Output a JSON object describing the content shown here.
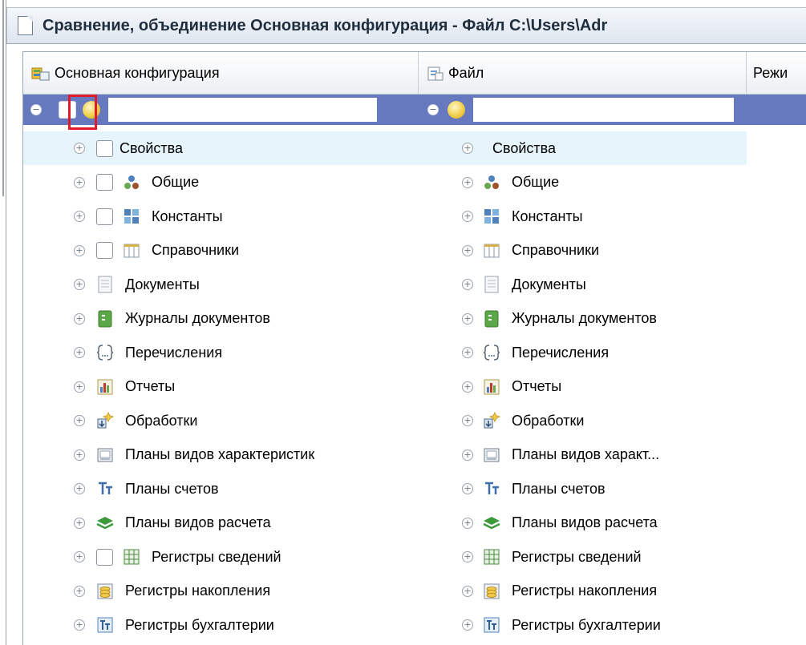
{
  "window": {
    "title": "Сравнение, объединение Основная конфигурация - Файл C:\\Users\\Adr"
  },
  "columns": {
    "left": "Основная конфигурация",
    "right": "Файл",
    "mode": "Режи"
  },
  "root": {
    "left_name": "",
    "right_name": "",
    "checkbox_checked": false
  },
  "rows": [
    {
      "label_left": "Свойства",
      "label_right": "Свойства",
      "icon": "none",
      "checkbox": true
    },
    {
      "label_left": "Общие",
      "label_right": "Общие",
      "icon": "common-objects-icon",
      "checkbox": true
    },
    {
      "label_left": "Константы",
      "label_right": "Константы",
      "icon": "constants-icon",
      "checkbox": true
    },
    {
      "label_left": "Справочники",
      "label_right": "Справочники",
      "icon": "catalogs-icon",
      "checkbox": true
    },
    {
      "label_left": "Документы",
      "label_right": "Документы",
      "icon": "documents-icon",
      "checkbox": false
    },
    {
      "label_left": "Журналы документов",
      "label_right": "Журналы документов",
      "icon": "document-journals-icon",
      "checkbox": false
    },
    {
      "label_left": "Перечисления",
      "label_right": "Перечисления",
      "icon": "enumerations-icon",
      "checkbox": false
    },
    {
      "label_left": "Отчеты",
      "label_right": "Отчеты",
      "icon": "reports-icon",
      "checkbox": false
    },
    {
      "label_left": "Обработки",
      "label_right": "Обработки",
      "icon": "data-processors-icon",
      "checkbox": false
    },
    {
      "label_left": "Планы видов характеристик",
      "label_right": "Планы видов характ...",
      "icon": "characteristic-types-icon",
      "checkbox": false
    },
    {
      "label_left": "Планы счетов",
      "label_right": "Планы счетов",
      "icon": "charts-of-accounts-icon",
      "checkbox": false
    },
    {
      "label_left": "Планы видов расчета",
      "label_right": "Планы видов расчета",
      "icon": "calculation-types-icon",
      "checkbox": false
    },
    {
      "label_left": "Регистры сведений",
      "label_right": "Регистры сведений",
      "icon": "information-registers-icon",
      "checkbox": true
    },
    {
      "label_left": "Регистры накопления",
      "label_right": "Регистры накопления",
      "icon": "accumulation-registers-icon",
      "checkbox": false
    },
    {
      "label_left": "Регистры бухгалтерии",
      "label_right": "Регистры бухгалтерии",
      "icon": "accounting-registers-icon",
      "checkbox": false
    }
  ],
  "colors": {
    "selection": "#6679bf",
    "hover_row": "#e5f5fb",
    "highlight_box": "#e21b2b"
  }
}
